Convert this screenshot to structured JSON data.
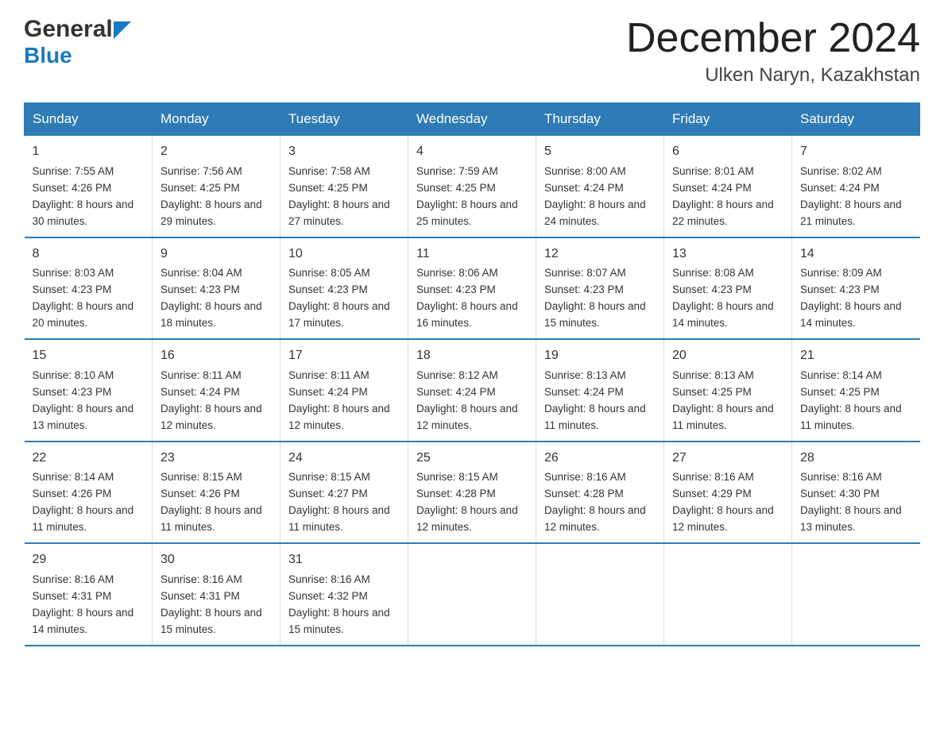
{
  "header": {
    "logo_general": "General",
    "logo_blue": "Blue",
    "month_title": "December 2024",
    "location": "Ulken Naryn, Kazakhstan"
  },
  "days_of_week": [
    "Sunday",
    "Monday",
    "Tuesday",
    "Wednesday",
    "Thursday",
    "Friday",
    "Saturday"
  ],
  "weeks": [
    [
      {
        "day": "1",
        "sunrise": "7:55 AM",
        "sunset": "4:26 PM",
        "daylight": "8 hours and 30 minutes."
      },
      {
        "day": "2",
        "sunrise": "7:56 AM",
        "sunset": "4:25 PM",
        "daylight": "8 hours and 29 minutes."
      },
      {
        "day": "3",
        "sunrise": "7:58 AM",
        "sunset": "4:25 PM",
        "daylight": "8 hours and 27 minutes."
      },
      {
        "day": "4",
        "sunrise": "7:59 AM",
        "sunset": "4:25 PM",
        "daylight": "8 hours and 25 minutes."
      },
      {
        "day": "5",
        "sunrise": "8:00 AM",
        "sunset": "4:24 PM",
        "daylight": "8 hours and 24 minutes."
      },
      {
        "day": "6",
        "sunrise": "8:01 AM",
        "sunset": "4:24 PM",
        "daylight": "8 hours and 22 minutes."
      },
      {
        "day": "7",
        "sunrise": "8:02 AM",
        "sunset": "4:24 PM",
        "daylight": "8 hours and 21 minutes."
      }
    ],
    [
      {
        "day": "8",
        "sunrise": "8:03 AM",
        "sunset": "4:23 PM",
        "daylight": "8 hours and 20 minutes."
      },
      {
        "day": "9",
        "sunrise": "8:04 AM",
        "sunset": "4:23 PM",
        "daylight": "8 hours and 18 minutes."
      },
      {
        "day": "10",
        "sunrise": "8:05 AM",
        "sunset": "4:23 PM",
        "daylight": "8 hours and 17 minutes."
      },
      {
        "day": "11",
        "sunrise": "8:06 AM",
        "sunset": "4:23 PM",
        "daylight": "8 hours and 16 minutes."
      },
      {
        "day": "12",
        "sunrise": "8:07 AM",
        "sunset": "4:23 PM",
        "daylight": "8 hours and 15 minutes."
      },
      {
        "day": "13",
        "sunrise": "8:08 AM",
        "sunset": "4:23 PM",
        "daylight": "8 hours and 14 minutes."
      },
      {
        "day": "14",
        "sunrise": "8:09 AM",
        "sunset": "4:23 PM",
        "daylight": "8 hours and 14 minutes."
      }
    ],
    [
      {
        "day": "15",
        "sunrise": "8:10 AM",
        "sunset": "4:23 PM",
        "daylight": "8 hours and 13 minutes."
      },
      {
        "day": "16",
        "sunrise": "8:11 AM",
        "sunset": "4:24 PM",
        "daylight": "8 hours and 12 minutes."
      },
      {
        "day": "17",
        "sunrise": "8:11 AM",
        "sunset": "4:24 PM",
        "daylight": "8 hours and 12 minutes."
      },
      {
        "day": "18",
        "sunrise": "8:12 AM",
        "sunset": "4:24 PM",
        "daylight": "8 hours and 12 minutes."
      },
      {
        "day": "19",
        "sunrise": "8:13 AM",
        "sunset": "4:24 PM",
        "daylight": "8 hours and 11 minutes."
      },
      {
        "day": "20",
        "sunrise": "8:13 AM",
        "sunset": "4:25 PM",
        "daylight": "8 hours and 11 minutes."
      },
      {
        "day": "21",
        "sunrise": "8:14 AM",
        "sunset": "4:25 PM",
        "daylight": "8 hours and 11 minutes."
      }
    ],
    [
      {
        "day": "22",
        "sunrise": "8:14 AM",
        "sunset": "4:26 PM",
        "daylight": "8 hours and 11 minutes."
      },
      {
        "day": "23",
        "sunrise": "8:15 AM",
        "sunset": "4:26 PM",
        "daylight": "8 hours and 11 minutes."
      },
      {
        "day": "24",
        "sunrise": "8:15 AM",
        "sunset": "4:27 PM",
        "daylight": "8 hours and 11 minutes."
      },
      {
        "day": "25",
        "sunrise": "8:15 AM",
        "sunset": "4:28 PM",
        "daylight": "8 hours and 12 minutes."
      },
      {
        "day": "26",
        "sunrise": "8:16 AM",
        "sunset": "4:28 PM",
        "daylight": "8 hours and 12 minutes."
      },
      {
        "day": "27",
        "sunrise": "8:16 AM",
        "sunset": "4:29 PM",
        "daylight": "8 hours and 12 minutes."
      },
      {
        "day": "28",
        "sunrise": "8:16 AM",
        "sunset": "4:30 PM",
        "daylight": "8 hours and 13 minutes."
      }
    ],
    [
      {
        "day": "29",
        "sunrise": "8:16 AM",
        "sunset": "4:31 PM",
        "daylight": "8 hours and 14 minutes."
      },
      {
        "day": "30",
        "sunrise": "8:16 AM",
        "sunset": "4:31 PM",
        "daylight": "8 hours and 15 minutes."
      },
      {
        "day": "31",
        "sunrise": "8:16 AM",
        "sunset": "4:32 PM",
        "daylight": "8 hours and 15 minutes."
      },
      null,
      null,
      null,
      null
    ]
  ],
  "labels": {
    "sunrise": "Sunrise:",
    "sunset": "Sunset:",
    "daylight": "Daylight:"
  }
}
